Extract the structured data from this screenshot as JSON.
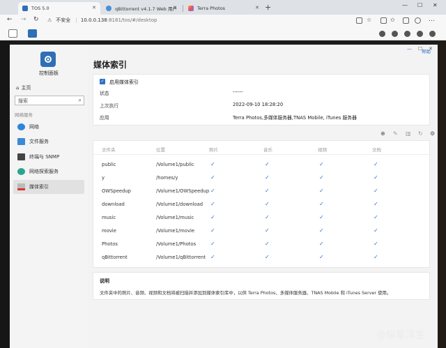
{
  "browser": {
    "tabs": [
      {
        "title": "TOS 5.0"
      },
      {
        "title": "qBittorrent v4.1.7 Web 用户界面"
      },
      {
        "title": "Terra Photos"
      }
    ],
    "address": {
      "security": "不安全",
      "host": "10.0.0.138",
      "path": ":8181/tos/#/desktop"
    }
  },
  "control_panel": {
    "title": "控制面板",
    "home": "主页",
    "search_placeholder": "搜索",
    "section_label": "网络服务",
    "nav": [
      {
        "label": "网络"
      },
      {
        "label": "文件服务"
      },
      {
        "label": "终端与 SNMP"
      },
      {
        "label": "网络探索服务"
      },
      {
        "label": "媒体索引"
      }
    ]
  },
  "main": {
    "title": "媒体索引",
    "help": "帮助",
    "enable_label": "启用媒体索引",
    "status_key": "状态",
    "status_value": "------",
    "last_run_key": "上次执行",
    "last_run_value": "2022-09-10 18:28:20",
    "apps_key": "应用",
    "apps_value": "Terra Photos,多媒体服务器,TNAS Mobile, iTunes 服务器",
    "columns": {
      "folder": "文件夹",
      "location": "位置",
      "photos": "照片",
      "music": "音乐",
      "video": "视频",
      "docs": "文档"
    },
    "rows": [
      {
        "folder": "public",
        "location": "/Volume1/public"
      },
      {
        "folder": "y",
        "location": "/homes/y"
      },
      {
        "folder": "OWSpeedup",
        "location": "/Volume1/OWSpeedup"
      },
      {
        "folder": "download",
        "location": "/Volume1/download"
      },
      {
        "folder": "music",
        "location": "/Volume1/music"
      },
      {
        "folder": "movie",
        "location": "/Volume1/movie"
      },
      {
        "folder": "Photos",
        "location": "/Volume1/Photos"
      },
      {
        "folder": "qBittorrent",
        "location": "/Volume1/qBittorrent"
      }
    ],
    "note_title": "说明",
    "note_text": "文件夹中的照片、音频、视频和文档将被扫描并添加到媒体索引库中，以供 Terra Photos、多媒体服务器、TNAS Mobile 和 iTunes Server 使用。"
  },
  "watermark": "@纵笔浮生"
}
